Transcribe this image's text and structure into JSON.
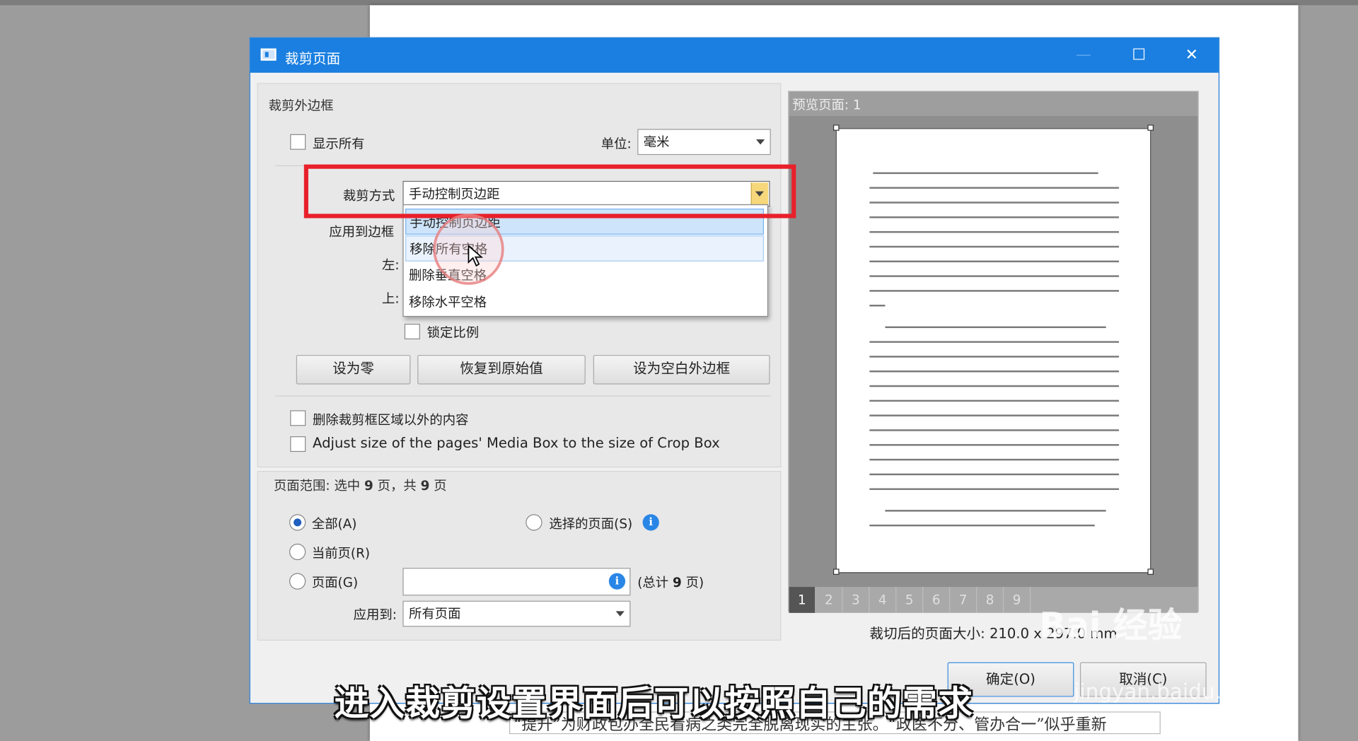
{
  "background_doc": {
    "bottom_text": "“提升”为财政包办全民看病之类完全脱离现实的主张。“政医不分、管办合一”似乎重新"
  },
  "dialog": {
    "title": "裁剪页面",
    "minimize": "—",
    "maximize": "☐",
    "close": "✕"
  },
  "crop_panel": {
    "header": "裁剪外边框",
    "show_all": "显示所有",
    "unit_label": "单位:",
    "unit_value": "毫米",
    "crop_method_label": "裁剪方式",
    "crop_method_value": "手动控制页边距",
    "apply_to_box_label": "应用到边框",
    "left_label": "左:",
    "top_label": "上:",
    "lock_ratio": "锁定比例",
    "set_zero": "设为零",
    "restore_original": "恢复到原始值",
    "set_white_margin": "设为空白外边框",
    "delete_outside": "删除裁剪框区域以外的内容",
    "adjust_media_box": "Adjust size of the pages' Media Box to the size of Crop Box"
  },
  "crop_method_options": [
    "手动控制页边距",
    "移除所有空格",
    "删除垂直空格",
    "移除水平空格"
  ],
  "page_range": {
    "header_prefix": "页面范围: 选中",
    "selected_count": "9",
    "header_mid": "页，共",
    "total_count": "9",
    "header_suffix": "页",
    "all": "全部(A)",
    "current": "当前页(R)",
    "pages": "页面(G)",
    "selected_pages": "选择的页面(S)",
    "pages_input": "",
    "total_pages_prefix": "(总计",
    "total_pages_num": "9",
    "total_pages_suffix": "页)",
    "apply_to_label": "应用到:",
    "apply_to_value": "所有页面"
  },
  "preview": {
    "header": "预览页面: 1",
    "pages": [
      "1",
      "2",
      "3",
      "4",
      "5",
      "6",
      "7",
      "8",
      "9"
    ],
    "active_page": "1",
    "size_text": "裁切后的页面大小: 210.0 x 297.0 mm"
  },
  "footer": {
    "ok": "确定(O)",
    "cancel": "取消(C)"
  },
  "overlay": {
    "subtitle": "进入裁剪设置界面后可以按照自己的需求",
    "watermark": "Bai 经验",
    "watermark_sub": "jingyan.baidu.com"
  },
  "colors": {
    "titlebar": "#1a7fe0",
    "highlight_box": "#e8202a",
    "selected_item": "#cde4fb",
    "active_page": "#555555"
  }
}
